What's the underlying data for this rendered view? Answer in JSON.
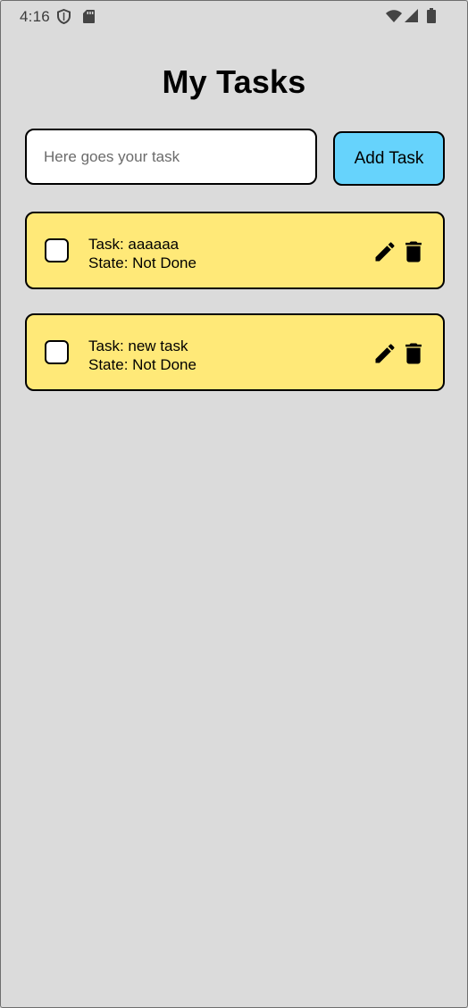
{
  "status_bar": {
    "time": "4:16",
    "icons": [
      "shield-icon",
      "sd-card-icon",
      "wifi-icon",
      "signal-icon",
      "battery-icon"
    ]
  },
  "title": "My Tasks",
  "input": {
    "placeholder": "Here goes your task",
    "value": ""
  },
  "add_button_label": "Add Task",
  "colors": {
    "background": "#dbdbdb",
    "card": "#ffe978",
    "button": "#66d3fc"
  },
  "tasks": [
    {
      "task_line": "Task: aaaaaa",
      "state_line": "State: Not Done",
      "done": false
    },
    {
      "task_line": "Task: new task",
      "state_line": "State: Not Done",
      "done": false
    }
  ]
}
